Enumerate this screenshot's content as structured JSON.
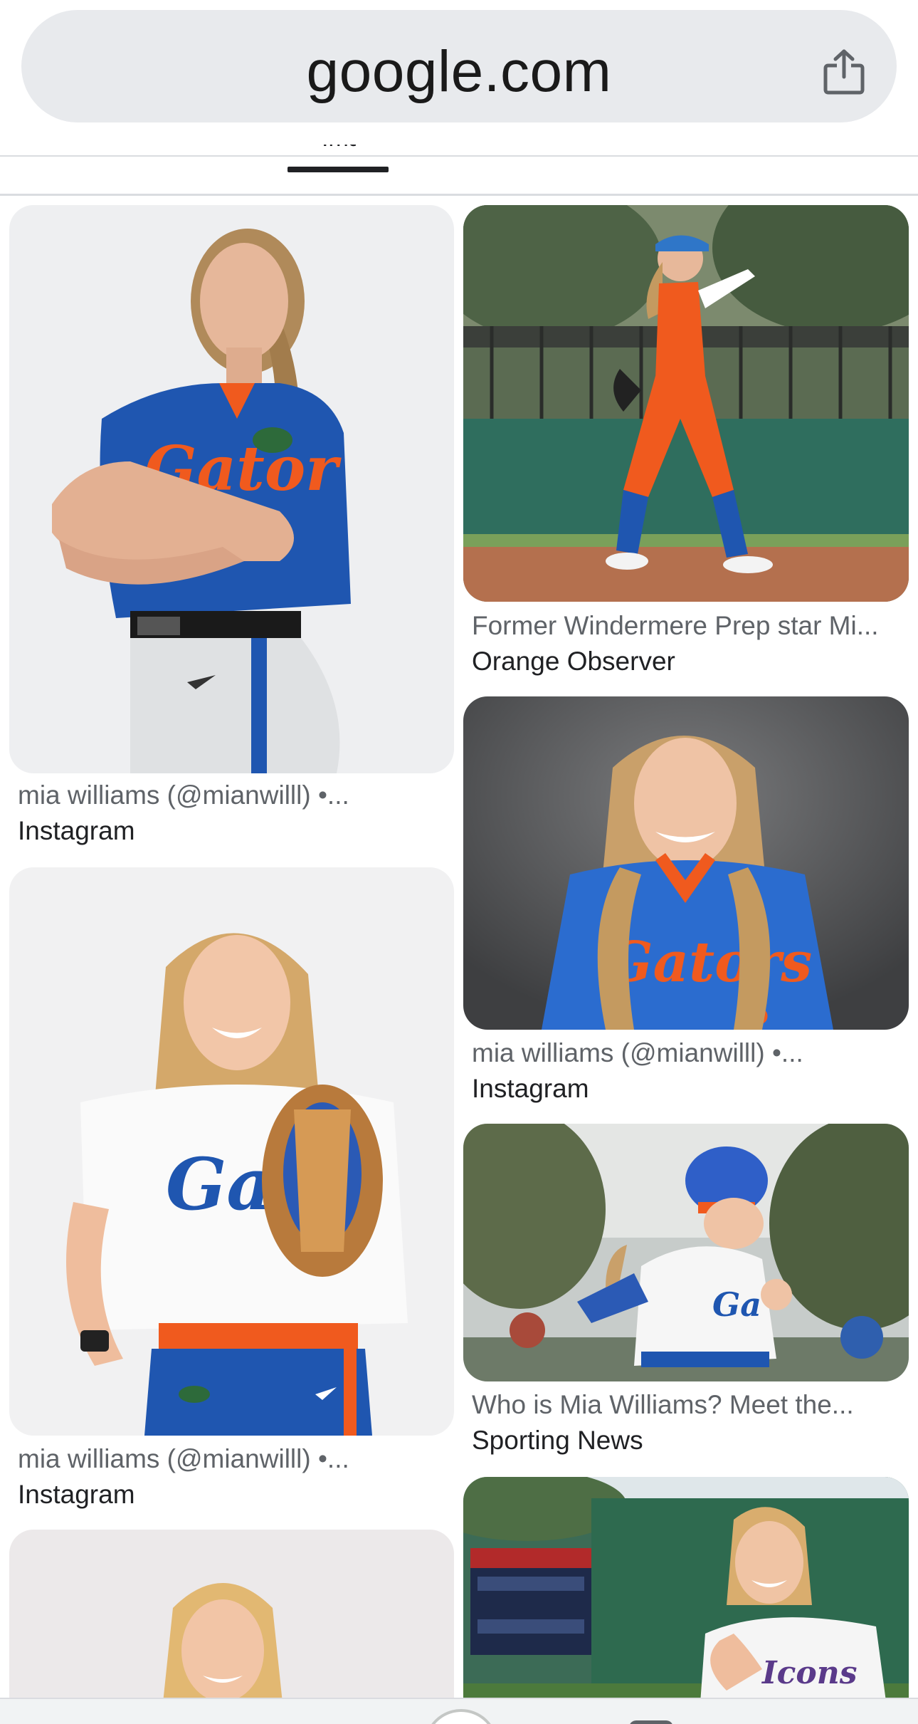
{
  "browser": {
    "url": "google.com",
    "share_icon": "share-icon"
  },
  "tabs": {
    "active_label": "Images"
  },
  "results": [
    {
      "title": "mia williams (@mianwilll) •...",
      "source": "Instagram",
      "image_desc": "softball player in blue Gators jersey, arms crossed"
    },
    {
      "title": "Former Windermere Prep star Mi...",
      "source": "Orange Observer",
      "image_desc": "softball player in orange uniform walking on field"
    },
    {
      "title": "mia williams (@mianwilll) •...",
      "source": "Instagram",
      "image_desc": "smiling player with long hair in blue Gators jersey"
    },
    {
      "title": "mia williams (@mianwilll) •...",
      "source": "Instagram",
      "image_desc": "smiling player in white Gators jersey holding glove"
    },
    {
      "title": "Who is Mia Williams? Meet the...",
      "source": "Sporting News",
      "image_desc": "player in helmet running bases"
    },
    {
      "title": "",
      "source": "",
      "image_desc": "smiling blonde player portrait"
    },
    {
      "title": "",
      "source": "",
      "image_desc": "player posing in front of scoreboard"
    }
  ],
  "colors": {
    "gators_blue": "#1f56b0",
    "gators_orange": "#f05a1e",
    "caption_gray": "#5f6368",
    "caption_dark": "#202124"
  }
}
